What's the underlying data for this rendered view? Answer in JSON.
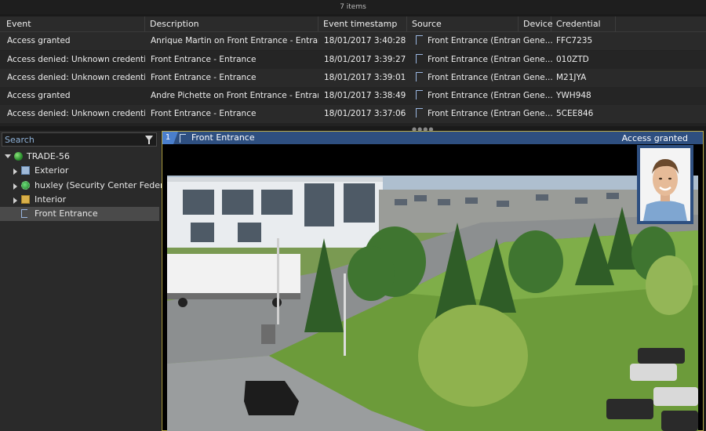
{
  "events_table": {
    "count_label": "7 items",
    "columns": [
      "Event",
      "Description",
      "Event timestamp",
      "Source",
      "Device",
      "Credential code"
    ],
    "rows": [
      {
        "event": "Access granted",
        "description": "Anrique Martin on Front Entrance - Entrance",
        "timestamp": "18/01/2017 3:40:28 PM",
        "source": "Front Entrance (Entrance)",
        "device": "Gene...",
        "credential": "FFC7235"
      },
      {
        "event": "Access denied: Unknown credential",
        "description": "Front Entrance - Entrance",
        "timestamp": "18/01/2017 3:39:27 PM",
        "source": "Front Entrance (Entrance)",
        "device": "Gene...",
        "credential": "010ZTD"
      },
      {
        "event": "Access denied: Unknown credential",
        "description": "Front Entrance - Entrance",
        "timestamp": "18/01/2017 3:39:01 PM",
        "source": "Front Entrance (Entrance)",
        "device": "Gene...",
        "credential": "M21JYA"
      },
      {
        "event": "Access granted",
        "description": "Andre Pichette on Front Entrance - Entrance",
        "timestamp": "18/01/2017 3:38:49 PM",
        "source": "Front Entrance (Entrance)",
        "device": "Gene...",
        "credential": "YWH948"
      },
      {
        "event": "Access denied: Unknown credential",
        "description": "Front Entrance - Entrance",
        "timestamp": "18/01/2017 3:37:06 PM",
        "source": "Front Entrance (Entrance)",
        "device": "Gene...",
        "credential": "5CEE846"
      }
    ]
  },
  "sidebar": {
    "search_placeholder": "Search",
    "tree": {
      "root": "TRADE-56",
      "items": [
        "Exterior",
        "huxley (Security Center Federation)",
        "Interior",
        "Front Entrance"
      ]
    }
  },
  "tile": {
    "number": "1",
    "title": "Front Entrance",
    "access_status": "Access granted"
  },
  "colors": {
    "tile_bar": "#2e4f80",
    "tile_border": "#b8a94a",
    "sort_arrow": "#4aa3e8"
  }
}
